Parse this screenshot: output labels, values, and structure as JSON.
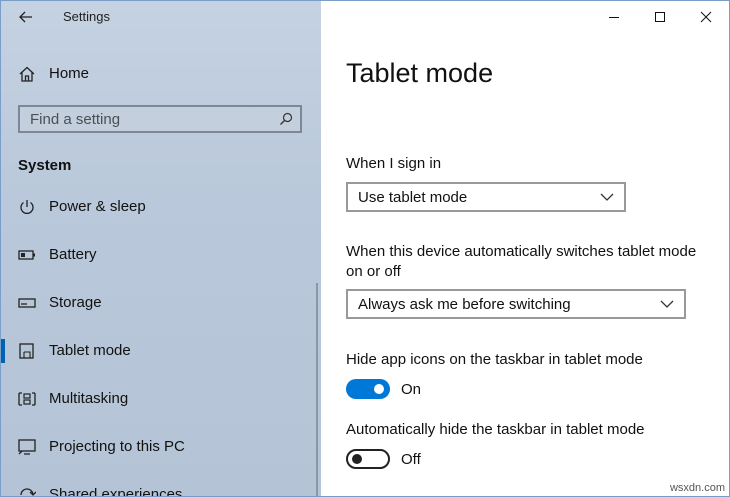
{
  "window": {
    "title": "Settings",
    "controls": [
      "minimize",
      "maximize",
      "close"
    ]
  },
  "sidebar": {
    "home_label": "Home",
    "search": {
      "placeholder": "Find a setting"
    },
    "section_title": "System",
    "items": [
      {
        "label": "Power & sleep",
        "icon": "power-icon"
      },
      {
        "label": "Battery",
        "icon": "battery-icon"
      },
      {
        "label": "Storage",
        "icon": "storage-icon"
      },
      {
        "label": "Tablet mode",
        "icon": "tablet-mode-icon",
        "active": true
      },
      {
        "label": "Multitasking",
        "icon": "multitasking-icon"
      },
      {
        "label": "Projecting to this PC",
        "icon": "projecting-icon"
      },
      {
        "label": "Shared experiences",
        "icon": "shared-experiences-icon"
      }
    ]
  },
  "main": {
    "title": "Tablet mode",
    "sign_in": {
      "label": "When I sign in",
      "value": "Use tablet mode"
    },
    "auto_switch": {
      "label_line1": "When this device automatically switches tablet mode",
      "label_line2": "on or off",
      "value": "Always ask me before switching"
    },
    "hide_icons": {
      "label": "Hide app icons on the taskbar in tablet mode",
      "state": "On",
      "enabled": true
    },
    "hide_taskbar": {
      "label": "Automatically hide the taskbar in tablet mode",
      "state": "Off",
      "enabled": false
    }
  },
  "watermark": "wsxdn.com",
  "colors": {
    "accent": "#0078d7",
    "sidebar_bg": "#bccadb",
    "active_bar": "#0063b1"
  }
}
